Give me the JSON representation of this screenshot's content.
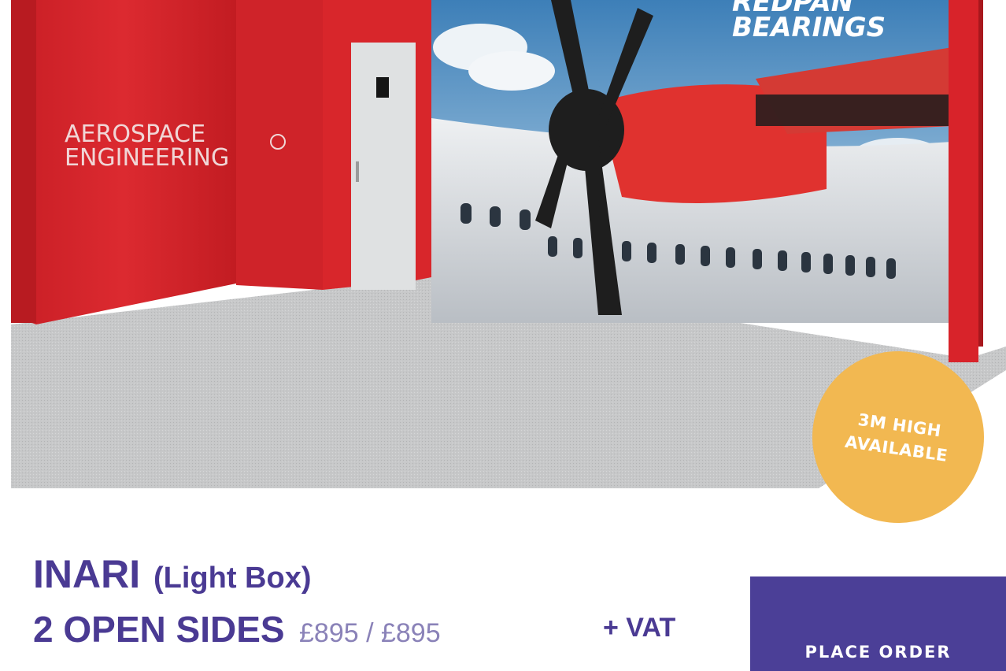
{
  "hero": {
    "left_wall_text_line1": "AEROSPACE",
    "left_wall_text_line2": "ENGINEERING",
    "brand_line1": "REDPAN",
    "brand_line2": "BEARINGS",
    "badge_line1": "3M HIGH",
    "badge_line2": "AVAILABLE"
  },
  "product": {
    "name": "INARI",
    "variant": "(Light Box)",
    "sides_label": "2 OPEN SIDES",
    "price": "£895 / £895",
    "vat_label": "+ VAT"
  },
  "actions": {
    "place_order_label": "PLACE ORDER"
  },
  "colors": {
    "accent": "#4b3f97",
    "badge": "#f2b851",
    "stand_red": "#d8232a"
  }
}
